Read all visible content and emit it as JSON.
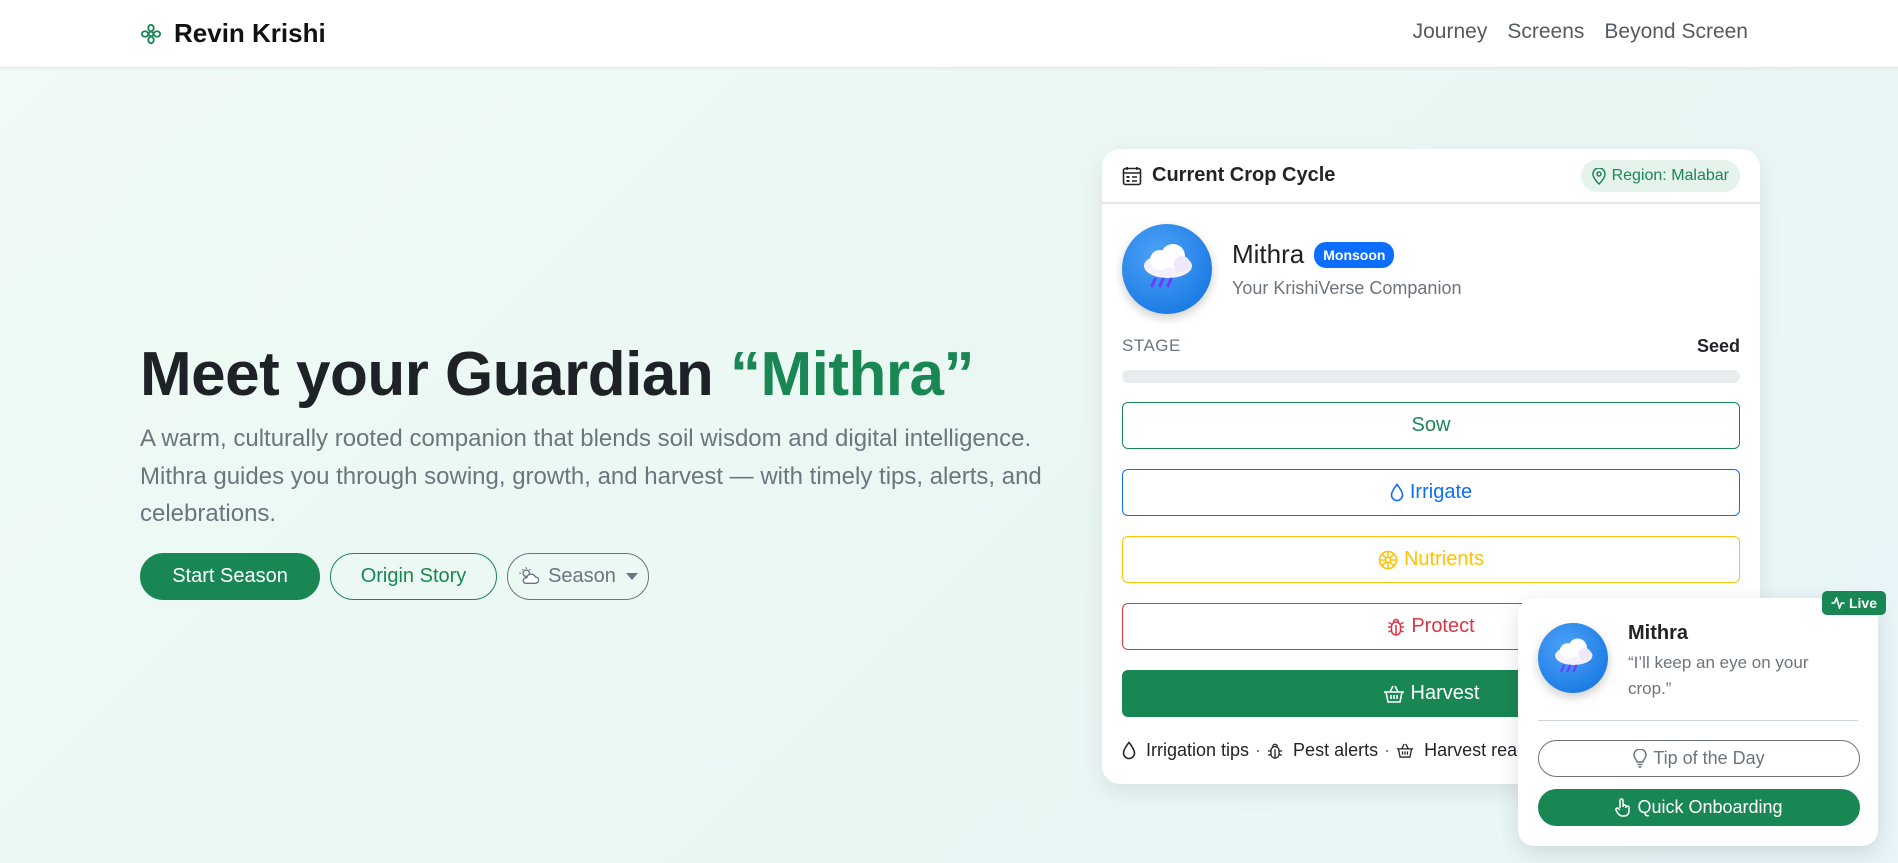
{
  "nav": {
    "brand": "Revin Krishi",
    "links": [
      "Journey",
      "Screens",
      "Beyond Screen"
    ]
  },
  "hero": {
    "title_main": "Meet your Guardian ",
    "title_accent": "“Mithra”",
    "lead": "A warm, culturally rooted companion that blends soil wisdom and digital intelligence. Mithra guides you through sowing, growth, and harvest — with timely tips, alerts, and celebrations.",
    "start_label": "Start Season",
    "origin_label": "Origin Story",
    "season_label": "Season"
  },
  "crop_card": {
    "title": "Current Crop Cycle",
    "region": "Region: Malabar",
    "companion_name": "Mithra",
    "companion_badge": "Monsoon",
    "companion_sub": "Your KrishiVerse Companion",
    "stage_label": "STAGE",
    "stage_value": "Seed",
    "progress": 0,
    "actions": {
      "sow": "Sow",
      "irrigate": "Irrigate",
      "nutrients": "Nutrients",
      "protect": "Protect",
      "harvest": "Harvest"
    },
    "features": {
      "irrigation": "Irrigation tips",
      "pest": "Pest alerts",
      "harvest": "Harvest readi"
    }
  },
  "widget": {
    "live": "Live",
    "name": "Mithra",
    "quote": "“I’ll keep an eye on your crop.”",
    "tip_label": "Tip of the Day",
    "onboard_label": "Quick Onboarding"
  },
  "colors": {
    "primary": "#198754",
    "blue": "#0d6efd",
    "warning": "#ffc107",
    "danger": "#dc3545",
    "muted": "#6c757d"
  },
  "icons": [
    "flower-icon",
    "calendar-icon",
    "location-pin-icon",
    "rain-cloud-icon",
    "droplet-icon",
    "flower-icon",
    "bug-icon",
    "basket-icon",
    "cloud-sun-icon",
    "activity-icon",
    "lightbulb-icon",
    "hand-pointer-icon"
  ]
}
